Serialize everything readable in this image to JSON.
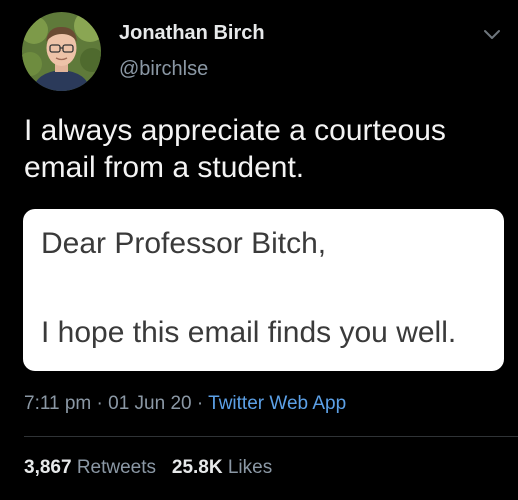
{
  "author": {
    "display_name": "Jonathan Birch",
    "handle": "@birchlse",
    "avatar_icon": "profile-photo"
  },
  "menu_icon": "chevron-down-icon",
  "tweet": {
    "text_line1": "I always appreciate a courteous",
    "text_line2": "email from a student."
  },
  "media": {
    "greeting": "Dear Professor Bitch,",
    "body": "I hope this email finds you well."
  },
  "meta": {
    "time": "7:11 pm",
    "separator": "·",
    "date": "01 Jun 20",
    "source": "Twitter Web App"
  },
  "stats": {
    "retweets_count": "3,867",
    "retweets_label": "Retweets",
    "likes_count": "25.8K",
    "likes_label": "Likes"
  },
  "colors": {
    "background": "#000000",
    "text_primary": "#e7e9ea",
    "text_secondary": "#8b98a5",
    "link": "#5ca0e6",
    "divider": "#2f3336"
  }
}
